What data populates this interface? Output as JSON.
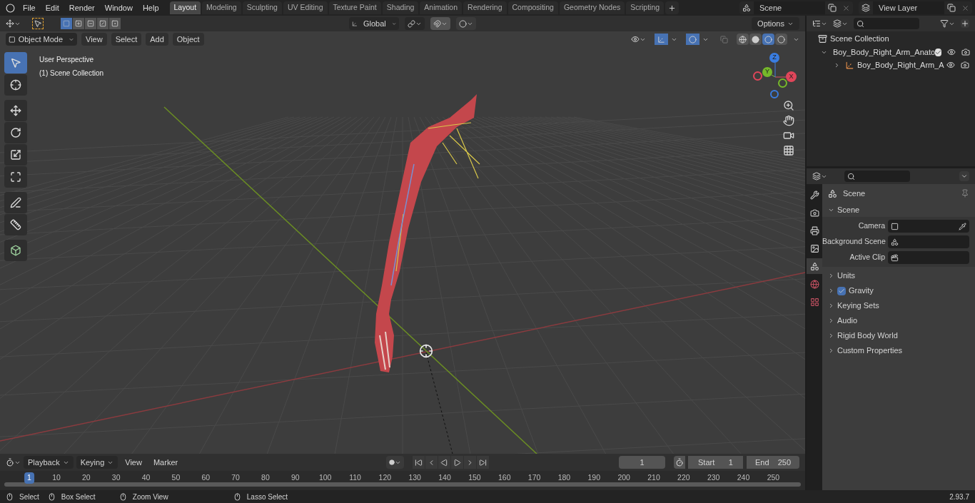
{
  "menu": [
    "File",
    "Edit",
    "Render",
    "Window",
    "Help"
  ],
  "workspaces": [
    {
      "label": "Layout",
      "selected": true
    },
    {
      "label": "Modeling",
      "selected": false
    },
    {
      "label": "Sculpting",
      "selected": false
    },
    {
      "label": "UV Editing",
      "selected": false
    },
    {
      "label": "Texture Paint",
      "selected": false
    },
    {
      "label": "Shading",
      "selected": false
    },
    {
      "label": "Animation",
      "selected": false
    },
    {
      "label": "Rendering",
      "selected": false
    },
    {
      "label": "Compositing",
      "selected": false
    },
    {
      "label": "Geometry Nodes",
      "selected": false
    },
    {
      "label": "Scripting",
      "selected": false
    }
  ],
  "scene": "Scene",
  "view_layer": "View Layer",
  "tool_header": {
    "select_modes": [
      {
        "kind": "set",
        "selected": true
      },
      {
        "kind": "extend",
        "selected": false
      },
      {
        "kind": "subtract",
        "selected": false
      },
      {
        "kind": "difference",
        "selected": false
      },
      {
        "kind": "intersect",
        "selected": false
      }
    ],
    "orientation": "Global",
    "options": "Options"
  },
  "viewport": {
    "mode": "Object Mode",
    "menus": [
      "View",
      "Select",
      "Add",
      "Object"
    ],
    "overlay_text": [
      "User Perspective",
      "(1) Scene Collection"
    ],
    "shading": [
      {
        "kind": "wireframe",
        "selected": false
      },
      {
        "kind": "solid",
        "selected": false
      },
      {
        "kind": "material",
        "selected": true
      },
      {
        "kind": "rendered",
        "selected": false
      }
    ],
    "tools": [
      {
        "kind": "select",
        "selected": true
      },
      {
        "kind": "cursor",
        "selected": false
      },
      {
        "kind": "move",
        "selected": false
      },
      {
        "kind": "rotate",
        "selected": false
      },
      {
        "kind": "scale",
        "selected": false
      },
      {
        "kind": "transform",
        "selected": false
      },
      {
        "kind": "annotate",
        "selected": false
      },
      {
        "kind": "measure",
        "selected": false
      },
      {
        "kind": "add_cube",
        "selected": false
      }
    ],
    "gizmo": {
      "x": "X",
      "y": "Y",
      "z": "Z"
    }
  },
  "outliner": {
    "root": "Scene Collection",
    "items": [
      {
        "label": "Boy_Body_Right_Arm_Anato",
        "kind": "collection",
        "expanded": true,
        "checked": true,
        "children": [
          {
            "label": "Boy_Body_Right_Arm_A",
            "kind": "armature",
            "expanded": false
          }
        ]
      }
    ]
  },
  "properties": {
    "tabs": [
      {
        "kind": "tool",
        "selected": false
      },
      {
        "kind": "render",
        "selected": false
      },
      {
        "kind": "output",
        "selected": false
      },
      {
        "kind": "view_layer",
        "selected": false
      },
      {
        "kind": "scene",
        "selected": true
      },
      {
        "kind": "world",
        "selected": false
      },
      {
        "kind": "texture",
        "selected": false
      }
    ],
    "context": "Scene",
    "panel": {
      "title": "Scene",
      "expanded": true,
      "fields": [
        {
          "label": "Camera",
          "kind": "camera"
        },
        {
          "label": "Background Scene",
          "kind": "scene"
        },
        {
          "label": "Active Clip",
          "kind": "clip"
        }
      ]
    },
    "subpanels": [
      {
        "label": "Units",
        "expanded": false
      },
      {
        "label": "Gravity",
        "expanded": false,
        "checked": true
      },
      {
        "label": "Keying Sets",
        "expanded": false
      },
      {
        "label": "Audio",
        "expanded": false
      },
      {
        "label": "Rigid Body World",
        "expanded": false
      },
      {
        "label": "Custom Properties",
        "expanded": false
      }
    ]
  },
  "timeline": {
    "menus": [
      {
        "label": "Playback",
        "dropdown": true
      },
      {
        "label": "Keying",
        "dropdown": true
      },
      {
        "label": "View",
        "dropdown": false
      },
      {
        "label": "Marker",
        "dropdown": false
      }
    ],
    "current_frame": "1",
    "start_label": "Start",
    "start": "1",
    "end_label": "End",
    "end": "250",
    "frames": [
      {
        "label": "1",
        "selected": true
      },
      {
        "label": "10",
        "selected": false
      },
      {
        "label": "20",
        "selected": false
      },
      {
        "label": "30",
        "selected": false
      },
      {
        "label": "40",
        "selected": false
      },
      {
        "label": "50",
        "selected": false
      },
      {
        "label": "60",
        "selected": false
      },
      {
        "label": "70",
        "selected": false
      },
      {
        "label": "80",
        "selected": false
      },
      {
        "label": "90",
        "selected": false
      },
      {
        "label": "100",
        "selected": false
      },
      {
        "label": "110",
        "selected": false
      },
      {
        "label": "120",
        "selected": false
      },
      {
        "label": "130",
        "selected": false
      },
      {
        "label": "140",
        "selected": false
      },
      {
        "label": "150",
        "selected": false
      },
      {
        "label": "160",
        "selected": false
      },
      {
        "label": "170",
        "selected": false
      },
      {
        "label": "180",
        "selected": false
      },
      {
        "label": "190",
        "selected": false
      },
      {
        "label": "200",
        "selected": false
      },
      {
        "label": "210",
        "selected": false
      },
      {
        "label": "220",
        "selected": false
      },
      {
        "label": "230",
        "selected": false
      },
      {
        "label": "240",
        "selected": false
      },
      {
        "label": "250",
        "selected": false
      }
    ]
  },
  "status_bar": {
    "hints": [
      "Select",
      "Box Select",
      "Zoom View",
      "Lasso Select"
    ],
    "version": "2.93.7"
  }
}
